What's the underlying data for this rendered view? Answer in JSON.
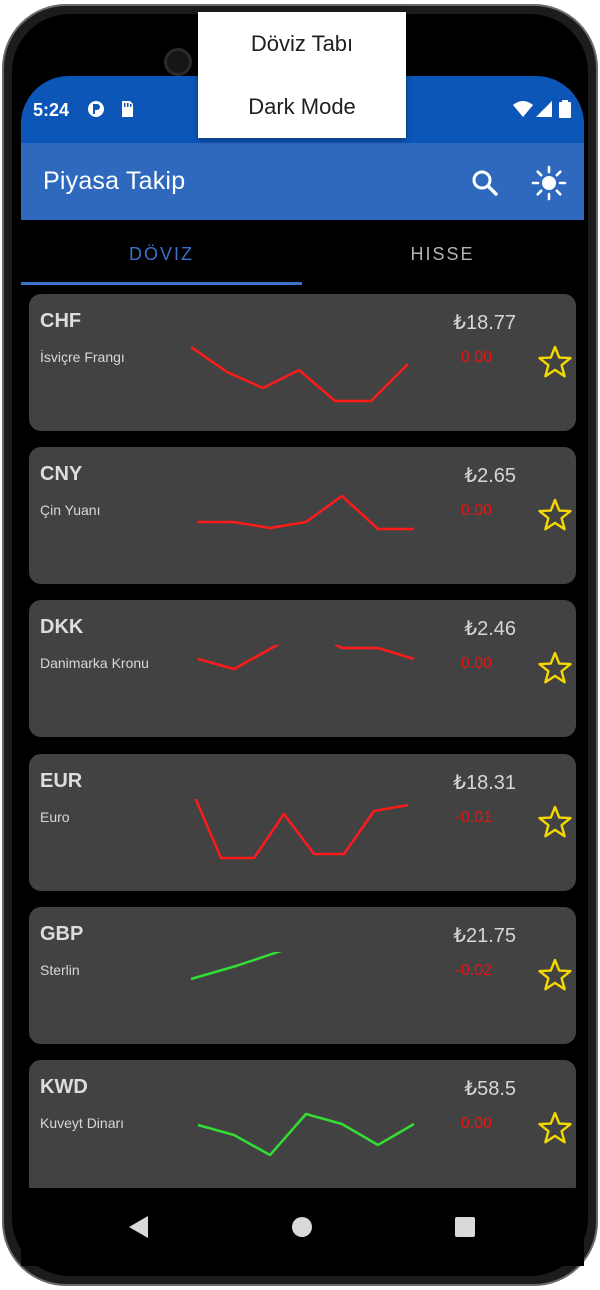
{
  "status_bar": {
    "time": "5:24"
  },
  "app_bar": {
    "title": "Piyasa Takip"
  },
  "tabs": [
    {
      "label": "DÖVIZ",
      "selected": true
    },
    {
      "label": "HISSE",
      "selected": false
    }
  ],
  "overflow_menu": {
    "items": [
      "Döviz Tabı",
      "Dark Mode"
    ]
  },
  "colors": {
    "status_bar": "#0c56b8",
    "app_bar": "#2e69be",
    "accent": "#3a72c9",
    "card": "#424242",
    "negative": "#e81313",
    "trend_down": "#ff1a1a",
    "trend_up": "#33dd33",
    "star": "#f5d800"
  },
  "currencies": [
    {
      "code": "CHF",
      "name": "İsviçre Frangı",
      "price": "₺18.77",
      "change": "0.00",
      "trend": "down",
      "favorite": false
    },
    {
      "code": "CNY",
      "name": "Çin Yuanı",
      "price": "₺2.65",
      "change": "0.00",
      "trend": "down",
      "favorite": false
    },
    {
      "code": "DKK",
      "name": "Danimarka Kronu",
      "price": "₺2.46",
      "change": "0.00",
      "trend": "down",
      "favorite": false
    },
    {
      "code": "EUR",
      "name": "Euro",
      "price": "₺18.31",
      "change": "-0.01",
      "trend": "down",
      "favorite": false
    },
    {
      "code": "GBP",
      "name": "Sterlin",
      "price": "₺21.75",
      "change": "-0.02",
      "trend": "up",
      "favorite": false
    },
    {
      "code": "KWD",
      "name": "Kuveyt Dinarı",
      "price": "₺58.5",
      "change": "0.00",
      "trend": "up",
      "favorite": false
    }
  ],
  "icons": {
    "search": "search-icon",
    "theme": "brightness-icon",
    "favorite": "star-outline-icon",
    "nav_back": "triangle-back-icon",
    "nav_home": "circle-home-icon",
    "nav_recents": "square-recents-icon"
  }
}
